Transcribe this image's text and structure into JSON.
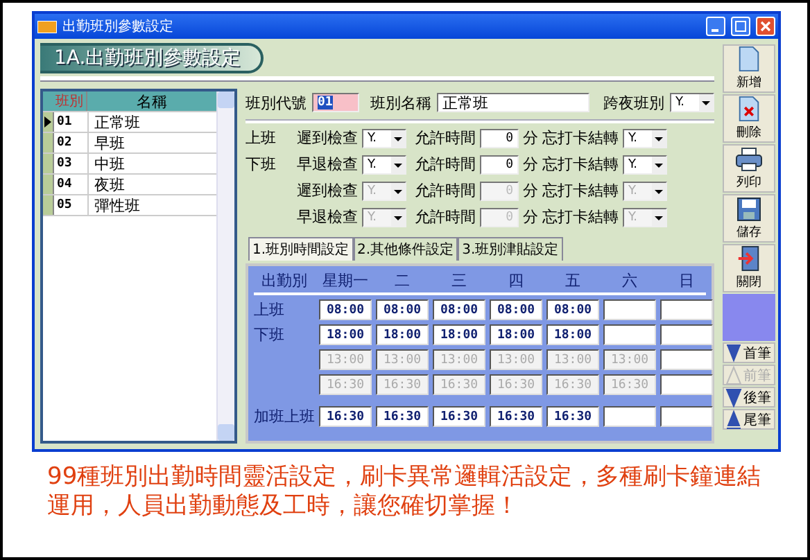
{
  "window": {
    "title": "出勤班別參數設定"
  },
  "header": {
    "title": "1A.出勤班別參數設定"
  },
  "shift_list": {
    "columns": [
      "班別",
      "名稱"
    ],
    "rows": [
      {
        "code": "01",
        "name": "正常班",
        "selected": true
      },
      {
        "code": "02",
        "name": "早班",
        "selected": false
      },
      {
        "code": "03",
        "name": "中班",
        "selected": false
      },
      {
        "code": "04",
        "name": "夜班",
        "selected": false
      },
      {
        "code": "05",
        "name": "彈性班",
        "selected": false
      }
    ]
  },
  "form": {
    "code_label": "班別代號",
    "code": "01",
    "name_label": "班別名稱",
    "name": "正常班",
    "overnight_label": "跨夜班別",
    "overnight": "Y."
  },
  "checks": [
    {
      "group": "上班",
      "label": "遲到檢查",
      "value": "Y.",
      "allow_label": "允許時間",
      "minutes": "0",
      "unit": "分",
      "forget_label": "忘打卡結轉",
      "forget_value": "Y.",
      "disabled": false
    },
    {
      "group": "下班",
      "label": "早退檢查",
      "value": "Y.",
      "allow_label": "允許時間",
      "minutes": "0",
      "unit": "分",
      "forget_label": "忘打卡結轉",
      "forget_value": "Y.",
      "disabled": false
    },
    {
      "label": "遲到檢查",
      "value": "Y.",
      "allow_label": "允許時間",
      "minutes": "0",
      "unit": "分",
      "forget_label": "忘打卡結轉",
      "forget_value": "Y.",
      "disabled": true
    },
    {
      "label": "早退檢查",
      "value": "Y.",
      "allow_label": "允許時間",
      "minutes": "0",
      "unit": "分",
      "forget_label": "忘打卡結轉",
      "forget_value": "Y.",
      "disabled": true
    }
  ],
  "tabs": [
    {
      "label": "1.班別時間設定",
      "selected": true
    },
    {
      "label": "2.其他條件設定",
      "selected": false
    },
    {
      "label": "3.班別津貼設定",
      "selected": false
    }
  ],
  "schedule": {
    "row_header": "出勤別",
    "columns": [
      "星期一",
      "二",
      "三",
      "四",
      "五",
      "六",
      "日"
    ],
    "rows": [
      {
        "label": "上班",
        "cells": [
          {
            "value": "08:00",
            "disabled": false
          },
          {
            "value": "08:00",
            "disabled": false
          },
          {
            "value": "08:00",
            "disabled": false
          },
          {
            "value": "08:00",
            "disabled": false
          },
          {
            "value": "08:00",
            "disabled": false
          },
          {
            "disabled": false
          },
          {
            "disabled": false
          }
        ]
      },
      {
        "label": "下班",
        "cells": [
          {
            "value": "18:00",
            "disabled": false
          },
          {
            "value": "18:00",
            "disabled": false
          },
          {
            "value": "18:00",
            "disabled": false
          },
          {
            "value": "18:00",
            "disabled": false
          },
          {
            "value": "18:00",
            "disabled": false
          },
          {
            "disabled": false
          },
          {
            "disabled": false
          }
        ]
      },
      {
        "cells": [
          {
            "value": "13:00",
            "disabled": true
          },
          {
            "value": "13:00",
            "disabled": true
          },
          {
            "value": "13:00",
            "disabled": true
          },
          {
            "value": "13:00",
            "disabled": true
          },
          {
            "value": "13:00",
            "disabled": true
          },
          {
            "value": "13:00",
            "disabled": true
          },
          {
            "disabled": false
          }
        ]
      },
      {
        "cells": [
          {
            "value": "16:30",
            "disabled": true
          },
          {
            "value": "16:30",
            "disabled": true
          },
          {
            "value": "16:30",
            "disabled": true
          },
          {
            "value": "16:30",
            "disabled": true
          },
          {
            "value": "16:30",
            "disabled": true
          },
          {
            "value": "16:30",
            "disabled": true
          },
          {
            "disabled": false
          }
        ]
      },
      {
        "label": "加班上班",
        "cells": [
          {
            "value": "16:30",
            "disabled": false
          },
          {
            "value": "16:30",
            "disabled": false
          },
          {
            "value": "16:30",
            "disabled": false
          },
          {
            "value": "16:30",
            "disabled": false
          },
          {
            "value": "16:30",
            "disabled": false
          },
          {
            "disabled": false
          },
          {
            "disabled": false
          }
        ]
      }
    ]
  },
  "toolbar": [
    {
      "kind": "new",
      "label": "新增"
    },
    {
      "kind": "delete",
      "label": "刪除"
    },
    {
      "kind": "print",
      "label": "列印"
    },
    {
      "kind": "save",
      "label": "儲存"
    },
    {
      "kind": "close",
      "label": "關閉"
    }
  ],
  "navigation": [
    {
      "kind": "first",
      "label": "首筆",
      "disabled": false
    },
    {
      "kind": "prev",
      "label": "前筆",
      "disabled": true
    },
    {
      "kind": "next",
      "label": "後筆",
      "disabled": false
    },
    {
      "kind": "last",
      "label": "尾筆",
      "disabled": false
    }
  ],
  "caption": "99種班別出勤時間靈活設定，刷卡異常邏輯活設定，多種刷卡鐘連結運用，人員出勤動態及工時，讓您確切掌握！"
}
